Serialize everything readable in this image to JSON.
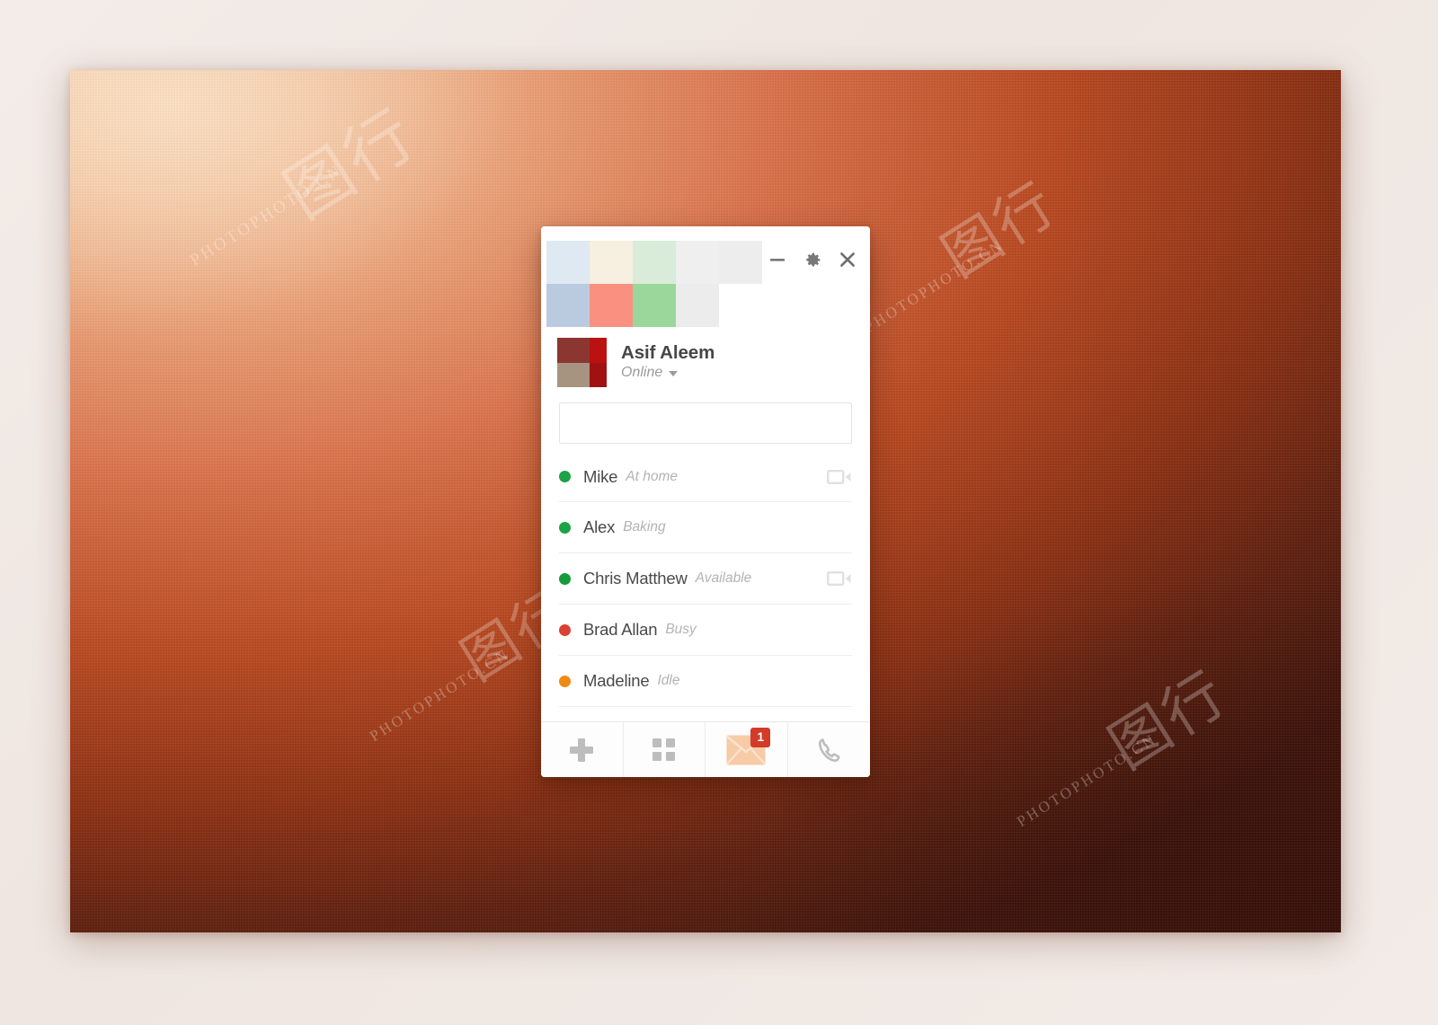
{
  "window": {
    "title_swatches_top": [
      "#dfe9f2",
      "#f7efe0",
      "#d9ecd9",
      "#efefef",
      "#ededed"
    ],
    "title_swatches_bottom": [
      "#bacbe0",
      "#fa9080",
      "#9bd79b",
      "#ececec",
      "#ffffff"
    ],
    "controls": [
      {
        "name": "minimize-button",
        "icon": "minimize-icon",
        "label": "Minimize"
      },
      {
        "name": "settings-button",
        "icon": "gear-icon",
        "label": "Settings"
      },
      {
        "name": "close-button",
        "icon": "close-icon",
        "label": "Close"
      }
    ]
  },
  "profile": {
    "name": "Asif Aleem",
    "presence": "Online",
    "avatar_colors": {
      "top_left": "#8c3631",
      "right": "#bb1111",
      "bottom_left": "#a79480",
      "bottom_right": "#a01212"
    }
  },
  "search": {
    "value": "",
    "placeholder": ""
  },
  "contacts": [
    {
      "name": "Mike",
      "status": "At home",
      "dot_color": "#1ba345",
      "has_video": true
    },
    {
      "name": "Alex",
      "status": "Baking",
      "dot_color": "#1ba345",
      "has_video": false
    },
    {
      "name": "Chris Matthew",
      "status": "Available",
      "dot_color": "#159b3c",
      "has_video": true
    },
    {
      "name": "Brad Allan",
      "status": "Busy",
      "dot_color": "#dc4034",
      "has_video": false
    },
    {
      "name": "Madeline",
      "status": "Idle",
      "dot_color": "#f08a12",
      "has_video": false
    }
  ],
  "toolbar": {
    "add_label": "Add contact",
    "apps_label": "Apps",
    "messages_label": "Messages",
    "messages_badge": "1",
    "call_label": "Call"
  },
  "colors": {
    "accent_red": "#d23b28",
    "envelope": "#f6cba6",
    "icon_gray": "#bdbdbd",
    "wallpaper_light": "#f7d4b6",
    "wallpaper_mid": "#d1714f",
    "wallpaper_dark": "#4a1a10"
  },
  "watermarks": [
    {
      "text": "PHOTOPHOTO.CN",
      "label": "PHOTO.CN"
    }
  ]
}
